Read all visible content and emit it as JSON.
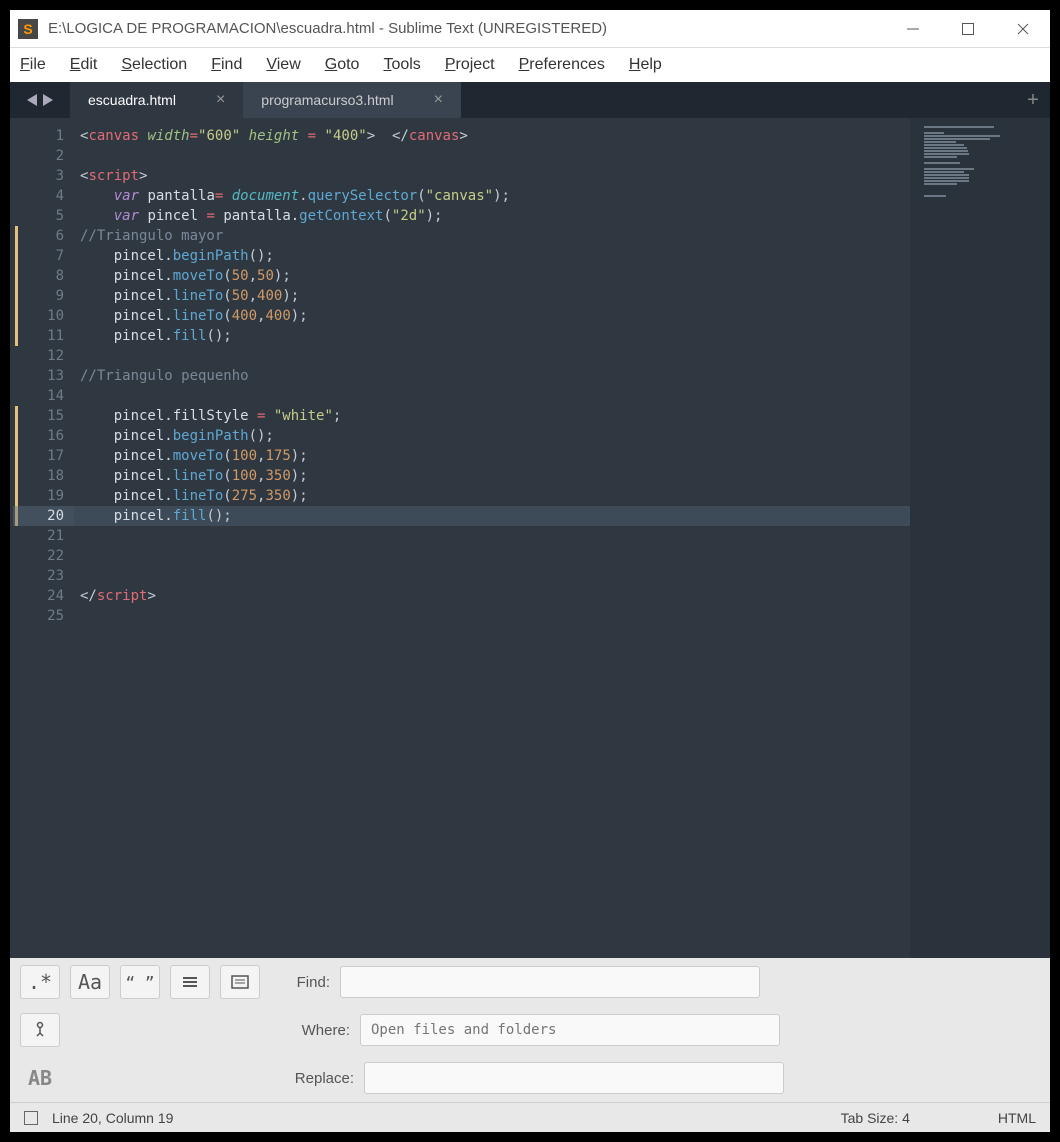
{
  "titlebar": {
    "title": "E:\\LOGICA DE PROGRAMACION\\escuadra.html - Sublime Text (UNREGISTERED)"
  },
  "menu": {
    "items": [
      "File",
      "Edit",
      "Selection",
      "Find",
      "View",
      "Goto",
      "Tools",
      "Project",
      "Preferences",
      "Help"
    ]
  },
  "tabs": {
    "items": [
      {
        "label": "escuadra.html",
        "active": true
      },
      {
        "label": "programacurso3.html",
        "active": false
      }
    ]
  },
  "editor": {
    "highlight_line": 20,
    "mod_ranges": [
      [
        6,
        11
      ],
      [
        15,
        20
      ]
    ],
    "lines": [
      [
        {
          "t": "<",
          "c": "c-pun"
        },
        {
          "t": "canvas",
          "c": "c-tag"
        },
        {
          "t": " ",
          "c": ""
        },
        {
          "t": "width",
          "c": "c-attr"
        },
        {
          "t": "=",
          "c": "c-op"
        },
        {
          "t": "\"600\"",
          "c": "c-str"
        },
        {
          "t": " ",
          "c": ""
        },
        {
          "t": "height",
          "c": "c-attr"
        },
        {
          "t": " ",
          "c": ""
        },
        {
          "t": "=",
          "c": "c-op"
        },
        {
          "t": " ",
          "c": ""
        },
        {
          "t": "\"400\"",
          "c": "c-str"
        },
        {
          "t": ">  </",
          "c": "c-pun"
        },
        {
          "t": "canvas",
          "c": "c-tag"
        },
        {
          "t": ">",
          "c": "c-pun"
        }
      ],
      [],
      [
        {
          "t": "<",
          "c": "c-pun"
        },
        {
          "t": "script",
          "c": "c-tag"
        },
        {
          "t": ">",
          "c": "c-pun"
        }
      ],
      [
        {
          "t": "    ",
          "c": ""
        },
        {
          "t": "var",
          "c": "c-kw"
        },
        {
          "t": " pantalla",
          "c": "c-id"
        },
        {
          "t": "= ",
          "c": "c-op"
        },
        {
          "t": "document",
          "c": "c-obj"
        },
        {
          "t": ".",
          "c": "c-pun"
        },
        {
          "t": "querySelector",
          "c": "c-fn"
        },
        {
          "t": "(",
          "c": "c-pun"
        },
        {
          "t": "\"canvas\"",
          "c": "c-str"
        },
        {
          "t": ");",
          "c": "c-pun"
        }
      ],
      [
        {
          "t": "    ",
          "c": ""
        },
        {
          "t": "var",
          "c": "c-kw"
        },
        {
          "t": " pincel ",
          "c": "c-id"
        },
        {
          "t": "= ",
          "c": "c-op"
        },
        {
          "t": "pantalla.",
          "c": "c-id"
        },
        {
          "t": "getContext",
          "c": "c-fn"
        },
        {
          "t": "(",
          "c": "c-pun"
        },
        {
          "t": "\"2d\"",
          "c": "c-str"
        },
        {
          "t": ");",
          "c": "c-pun"
        }
      ],
      [
        {
          "t": "//Triangulo mayor",
          "c": "c-cmt"
        }
      ],
      [
        {
          "t": "    pincel.",
          "c": "c-id"
        },
        {
          "t": "beginPath",
          "c": "c-fn"
        },
        {
          "t": "();",
          "c": "c-pun"
        }
      ],
      [
        {
          "t": "    pincel.",
          "c": "c-id"
        },
        {
          "t": "moveTo",
          "c": "c-fn"
        },
        {
          "t": "(",
          "c": "c-pun"
        },
        {
          "t": "50",
          "c": "c-num"
        },
        {
          "t": ",",
          "c": "c-pun"
        },
        {
          "t": "50",
          "c": "c-num"
        },
        {
          "t": ");",
          "c": "c-pun"
        }
      ],
      [
        {
          "t": "    pincel.",
          "c": "c-id"
        },
        {
          "t": "lineTo",
          "c": "c-fn"
        },
        {
          "t": "(",
          "c": "c-pun"
        },
        {
          "t": "50",
          "c": "c-num"
        },
        {
          "t": ",",
          "c": "c-pun"
        },
        {
          "t": "400",
          "c": "c-num"
        },
        {
          "t": ");",
          "c": "c-pun"
        }
      ],
      [
        {
          "t": "    pincel.",
          "c": "c-id"
        },
        {
          "t": "lineTo",
          "c": "c-fn"
        },
        {
          "t": "(",
          "c": "c-pun"
        },
        {
          "t": "400",
          "c": "c-num"
        },
        {
          "t": ",",
          "c": "c-pun"
        },
        {
          "t": "400",
          "c": "c-num"
        },
        {
          "t": ");",
          "c": "c-pun"
        }
      ],
      [
        {
          "t": "    pincel.",
          "c": "c-id"
        },
        {
          "t": "fill",
          "c": "c-fn"
        },
        {
          "t": "();",
          "c": "c-pun"
        }
      ],
      [],
      [
        {
          "t": "//Triangulo pequenho",
          "c": "c-cmt"
        }
      ],
      [],
      [
        {
          "t": "    pincel.fillStyle ",
          "c": "c-id"
        },
        {
          "t": "= ",
          "c": "c-op"
        },
        {
          "t": "\"white\"",
          "c": "c-str"
        },
        {
          "t": ";",
          "c": "c-pun"
        }
      ],
      [
        {
          "t": "    pincel.",
          "c": "c-id"
        },
        {
          "t": "beginPath",
          "c": "c-fn"
        },
        {
          "t": "();",
          "c": "c-pun"
        }
      ],
      [
        {
          "t": "    pincel.",
          "c": "c-id"
        },
        {
          "t": "moveTo",
          "c": "c-fn"
        },
        {
          "t": "(",
          "c": "c-pun"
        },
        {
          "t": "100",
          "c": "c-num"
        },
        {
          "t": ",",
          "c": "c-pun"
        },
        {
          "t": "175",
          "c": "c-num"
        },
        {
          "t": ");",
          "c": "c-pun"
        }
      ],
      [
        {
          "t": "    pincel.",
          "c": "c-id"
        },
        {
          "t": "lineTo",
          "c": "c-fn"
        },
        {
          "t": "(",
          "c": "c-pun"
        },
        {
          "t": "100",
          "c": "c-num"
        },
        {
          "t": ",",
          "c": "c-pun"
        },
        {
          "t": "350",
          "c": "c-num"
        },
        {
          "t": ");",
          "c": "c-pun"
        }
      ],
      [
        {
          "t": "    pincel.",
          "c": "c-id"
        },
        {
          "t": "lineTo",
          "c": "c-fn"
        },
        {
          "t": "(",
          "c": "c-pun"
        },
        {
          "t": "275",
          "c": "c-num"
        },
        {
          "t": ",",
          "c": "c-pun"
        },
        {
          "t": "350",
          "c": "c-num"
        },
        {
          "t": ");",
          "c": "c-pun"
        }
      ],
      [
        {
          "t": "    pincel.",
          "c": "c-id"
        },
        {
          "t": "fill",
          "c": "c-fn"
        },
        {
          "t": "();",
          "c": "c-pun"
        }
      ],
      [],
      [],
      [],
      [
        {
          "t": "</",
          "c": "c-pun"
        },
        {
          "t": "script",
          "c": "c-tag"
        },
        {
          "t": ">",
          "c": "c-pun"
        }
      ],
      []
    ]
  },
  "findbar": {
    "find_label": "Find:",
    "where_label": "Where:",
    "replace_label": "Replace:",
    "where_placeholder": "Open files and folders",
    "opts": {
      "regex": ".*",
      "case": "Aa",
      "quotes": "“ ”",
      "wrap": "≡",
      "ctx": "▣",
      "branch": "⎇",
      "preserve": "AB"
    }
  },
  "status": {
    "pos": "Line 20, Column 19",
    "tab": "Tab Size: 4",
    "lang": "HTML"
  }
}
